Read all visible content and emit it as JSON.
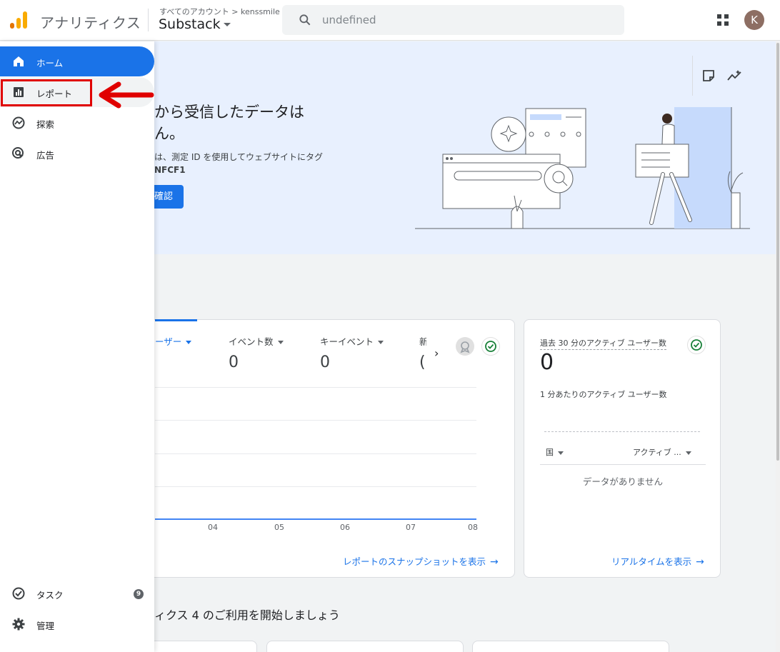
{
  "header": {
    "app_title": "アナリティクス",
    "breadcrumb": "すべてのアカウント > kenssmile",
    "property": "Substack",
    "search_value": "undefined",
    "avatar_letter": "K"
  },
  "sidebar": {
    "items": [
      {
        "label": "ホーム",
        "icon": "home-icon"
      },
      {
        "label": "レポート",
        "icon": "bar-chart-icon"
      },
      {
        "label": "探索",
        "icon": "explore-icon"
      },
      {
        "label": "広告",
        "icon": "ads-icon"
      }
    ],
    "bottom": [
      {
        "label": "タスク",
        "icon": "task-check-icon",
        "badge": "9"
      },
      {
        "label": "管理",
        "icon": "gear-icon"
      }
    ]
  },
  "hero": {
    "title_line1": "から受信したデータは",
    "title_line2": "ん。",
    "desc_line1": "は、測定 ID を使用してウェブサイトにタグ",
    "desc_line2": "NFCF1",
    "button": "確認"
  },
  "main_card": {
    "metrics": [
      {
        "label": "ーザー",
        "value": ""
      },
      {
        "label": "イベント数",
        "value": "0"
      },
      {
        "label": "キーイベント",
        "value": "0"
      },
      {
        "label": "新",
        "value": "("
      }
    ],
    "x_ticks": [
      "04",
      "05",
      "06",
      "07",
      "08"
    ],
    "link": "レポートのスナップショットを表示"
  },
  "realtime_card": {
    "title": "過去 30 分のアクティブ ユーザー数",
    "value": "0",
    "subtitle": "1 分あたりのアクティブ ユーザー数",
    "col1": "国",
    "col2": "アクティブ ...",
    "empty": "データがありません",
    "link": "リアルタイムを表示"
  },
  "section_title": "ィクス 4 のご利用を開始しましょう",
  "colors": {
    "accent": "#1a73e8",
    "hero_bg": "#e8f0fe",
    "annotation_red": "#e00000"
  }
}
